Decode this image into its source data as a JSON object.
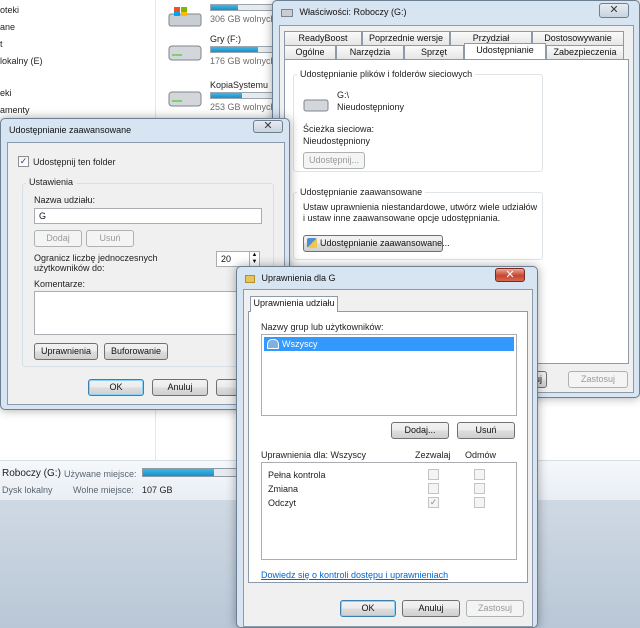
{
  "explorer": {
    "nav_items": [
      "oteki",
      "ane",
      "t",
      "lokalny (E)",
      "eki",
      "amenty"
    ],
    "drives": [
      {
        "name": "",
        "free": "306 GB wolnych",
        "fill": 0.35
      },
      {
        "name": "Gry (F:)",
        "free": "176 GB wolnych",
        "fill": 0.6
      },
      {
        "name": "KopiaSystemu",
        "free": "253 GB wolnych",
        "fill": 0.4
      }
    ],
    "details": {
      "drive_name": "Roboczy (G:)",
      "used_label": "Używane miejsce:",
      "type": "Dysk lokalny",
      "free_label": "Wolne miejsce:",
      "free_value": "107 GB",
      "used_fill": 0.72
    }
  },
  "properties": {
    "title": "Właściwości: Roboczy (G:)",
    "close_symbol": "✕",
    "tabs_row1": [
      "ReadyBoost",
      "Poprzednie wersje",
      "Przydział",
      "Dostosowywanie"
    ],
    "tabs_row2": [
      "Ogólne",
      "Narzędzia",
      "Sprzęt",
      "Udostępnianie",
      "Zabezpieczenia"
    ],
    "network_group_label": "Udostępnianie plików i folderów sieciowych",
    "drive_path": "G:\\",
    "share_status": "Nieudostępniony",
    "network_path_label": "Ścieżka sieciowa:",
    "network_path_value": "Nieudostępniony",
    "share_button": "Udostępnij...",
    "advanced_group_label": "Udostępnianie zaawansowane",
    "advanced_desc": "Ustaw uprawnienia niestandardowe, utwórz wiele udziałów i ustaw inne zaawansowane opcje udostępniania.",
    "advanced_button": "Udostępnianie zaawansowane...",
    "apply_button_partial": "uj",
    "apply_button": "Zastosuj"
  },
  "advanced": {
    "title": "Udostępnianie zaawansowane",
    "close_symbol": "✕",
    "share_checkbox_label": "Udostępnij ten folder",
    "share_checked": true,
    "settings_label": "Ustawienia",
    "share_name_label": "Nazwa udziału:",
    "share_name_value": "G",
    "add_button": "Dodaj",
    "remove_button": "Usuń",
    "limit_label": "Ogranicz liczbę jednoczesnych użytkowników do:",
    "limit_value": "20",
    "comments_label": "Komentarze:",
    "comments_value": "",
    "permissions_button": "Uprawnienia",
    "caching_button": "Buforowanie",
    "ok_button": "OK",
    "cancel_button": "Anuluj",
    "apply_button_partial": "Za"
  },
  "permissions": {
    "title": "Uprawnienia dla G",
    "close_symbol": "✕",
    "tab_label": "Uprawnienia udziału",
    "groups_label": "Nazwy grup lub użytkowników:",
    "groups": [
      "Wszyscy"
    ],
    "add_button": "Dodaj...",
    "remove_button": "Usuń",
    "perm_for_label": "Uprawnienia dla: Wszyscy",
    "allow_header": "Zezwalaj",
    "deny_header": "Odmów",
    "rows": [
      {
        "name": "Pełna kontrola",
        "allow": false,
        "deny": false
      },
      {
        "name": "Zmiana",
        "allow": false,
        "deny": false
      },
      {
        "name": "Odczyt",
        "allow": true,
        "deny": false
      }
    ],
    "help_link": "Dowiedz się o kontroli dostępu i uprawnieniach",
    "ok_button": "OK",
    "cancel_button": "Anuluj",
    "apply_button": "Zastosuj"
  }
}
